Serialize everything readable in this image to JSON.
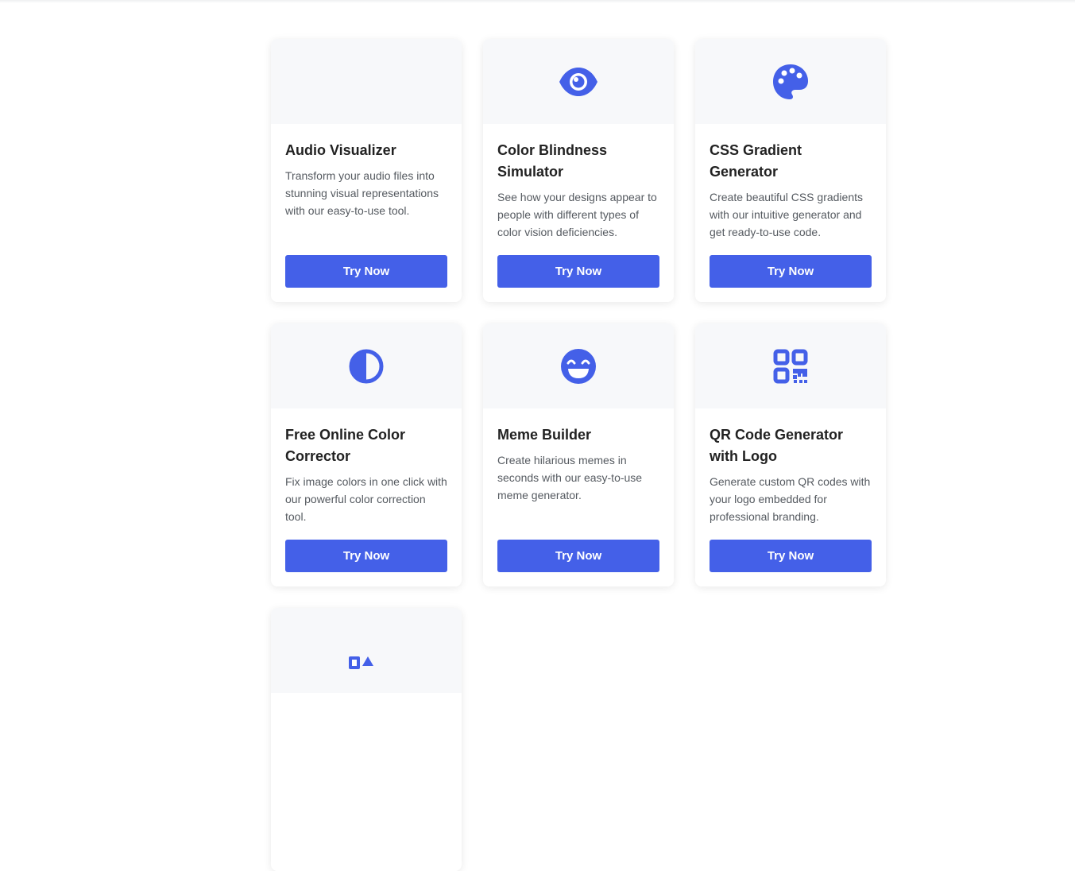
{
  "colors": {
    "accent": "#4460e8",
    "icon_area_bg": "#f7f8fa",
    "title_text": "#222222",
    "description_text": "#555a60"
  },
  "cards": [
    {
      "icon": "none",
      "title": "Audio Visualizer",
      "description": "Transform your audio files into stunning visual representations with our easy-to-use tool.",
      "button_label": "Try Now"
    },
    {
      "icon": "eye-icon",
      "title": "Color Blindness Simulator",
      "description": "See how your designs appear to people with different types of color vision deficiencies.",
      "button_label": "Try Now"
    },
    {
      "icon": "palette-icon",
      "title": "CSS Gradient Generator",
      "description": "Create beautiful CSS gradients with our intuitive generator and get ready-to-use code.",
      "button_label": "Try Now"
    },
    {
      "icon": "half-circle-contrast-icon",
      "title": "Free Online Color Corrector",
      "description": "Fix image colors in one click with our powerful color correction tool.",
      "button_label": "Try Now"
    },
    {
      "icon": "laughing-face-icon",
      "title": "Meme Builder",
      "description": "Create hilarious memes in seconds with our easy-to-use meme generator.",
      "button_label": "Try Now"
    },
    {
      "icon": "qr-code-icon",
      "title": "QR Code Generator with Logo",
      "description": "Generate custom QR codes with your logo embedded for professional branding.",
      "button_label": "Try Now"
    },
    {
      "icon": "shapes-icon"
    }
  ]
}
